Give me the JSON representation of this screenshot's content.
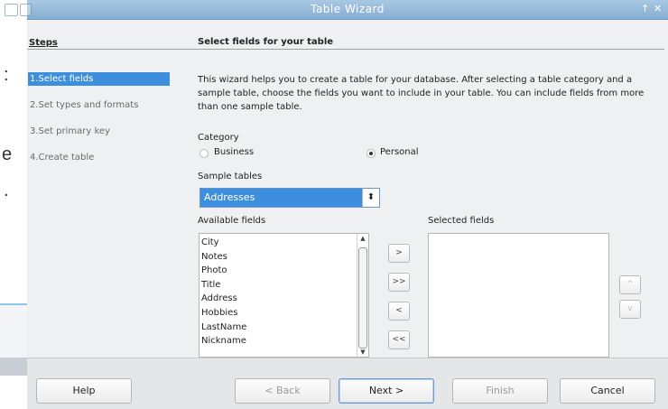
{
  "background_app": {
    "fragments": [
      ":",
      "e",
      "."
    ]
  },
  "window": {
    "title": "Table Wizard",
    "controls": [
      "↑",
      "✕"
    ]
  },
  "steps": {
    "title": "Steps",
    "items": [
      {
        "label": "1.Select fields",
        "selected": true
      },
      {
        "label": "2.Set types and formats",
        "selected": false
      },
      {
        "label": "3.Set primary key",
        "selected": false
      },
      {
        "label": "4.Create table",
        "selected": false
      }
    ]
  },
  "main": {
    "heading": "Select fields for your table",
    "description": "This wizard helps you to create a table for your database. After selecting a table category and a sample table, choose the fields you want to include in your table. You can include fields from more than one sample table.",
    "category": {
      "label": "Category",
      "options": [
        "Business",
        "Personal"
      ],
      "selected": "Personal"
    },
    "sample_tables": {
      "label": "Sample tables",
      "value": "Addresses"
    },
    "available_fields": {
      "label": "Available fields",
      "items": [
        "City",
        "Notes",
        "Photo",
        "Title",
        "Address",
        "Hobbies",
        "LastName",
        "Nickname"
      ]
    },
    "selected_fields": {
      "label": "Selected fields",
      "items": []
    },
    "move_buttons": [
      ">",
      ">>",
      "<",
      "<<"
    ],
    "order_buttons": [
      "^",
      "v"
    ]
  },
  "footer": {
    "help": "Help",
    "back": "< Back",
    "next": "Next >",
    "finish": "Finish",
    "cancel": "Cancel"
  },
  "colors": {
    "selection": "#3d8fde",
    "titlebar": "#85aed4"
  }
}
